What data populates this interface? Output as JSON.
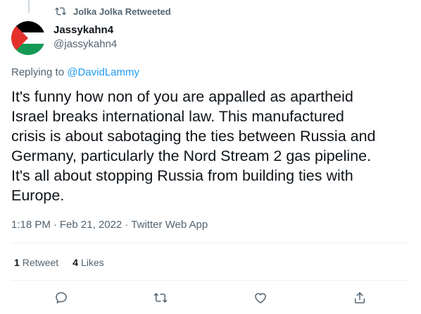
{
  "retweet_context": {
    "text": "Jolka Jolka Retweeted",
    "icon": "retweet-icon"
  },
  "author": {
    "name": "Jassykahn4",
    "handle": "@jassykahn4",
    "avatar": "palestine-flag-avatar",
    "flag_colors": {
      "black": "#000000",
      "white": "#ffffff",
      "green": "#149954",
      "red": "#e4312b"
    }
  },
  "reply": {
    "prefix": "Replying to ",
    "mention": "@DavidLammy"
  },
  "tweet": {
    "lines": [
      "It's funny how non of you are appalled as apartheid",
      "Israel breaks international law. This manufactured",
      "crisis is about sabotaging the ties between Russia and",
      "Germany, particularly the Nord Stream 2 gas pipeline.",
      "It's all about stopping Russia from building ties with",
      "Europe."
    ]
  },
  "meta": {
    "time": "1:18 PM",
    "sep1": "·",
    "date": "Feb 21, 2022",
    "sep2": "·",
    "source": "Twitter Web App"
  },
  "stats": {
    "retweets_count": "1",
    "retweets_label": "Retweet",
    "likes_count": "4",
    "likes_label": "Likes"
  },
  "actions": [
    "reply-icon",
    "retweet-icon",
    "like-heart-icon",
    "share-icon"
  ],
  "colors": {
    "text": "#0f1419",
    "secondary": "#536471",
    "link": "#1d9bf0",
    "divider": "#eff3f4"
  }
}
